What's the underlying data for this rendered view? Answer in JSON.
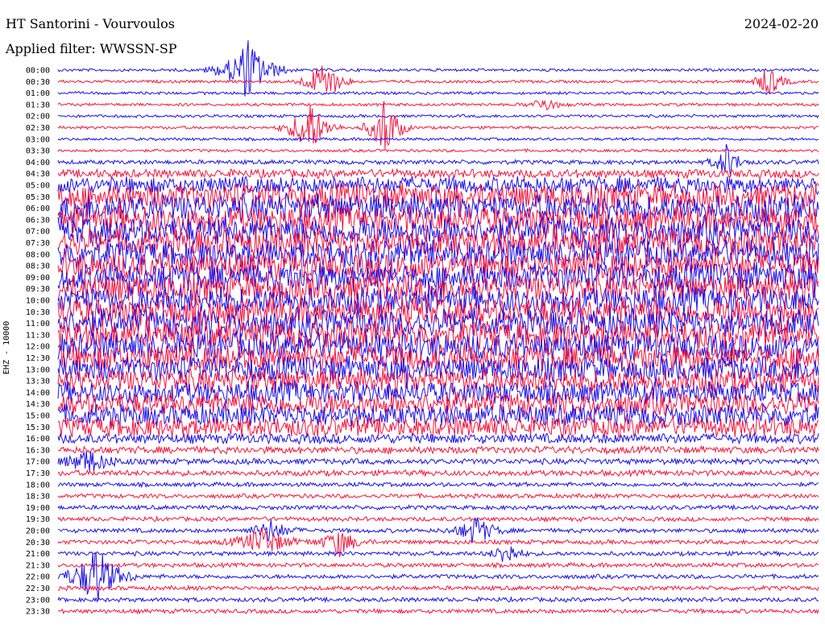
{
  "header": {
    "title": "HT Santorini - Vourvoulos",
    "filter": "Applied filter: WWSSN-SP",
    "date": "2024-02-20"
  },
  "chart_data": {
    "type": "line",
    "title": "HT Santorini - Vourvoulos",
    "subtitle": "Applied filter: WWSSN-SP",
    "ylabel": "EHZ - 10000",
    "colors": [
      "#1a10e8",
      "#f5143c"
    ],
    "categories": [
      "00:00",
      "00:30",
      "01:00",
      "01:30",
      "02:00",
      "02:30",
      "03:00",
      "03:30",
      "04:00",
      "04:30",
      "05:00",
      "05:30",
      "06:00",
      "06:30",
      "07:00",
      "07:30",
      "08:00",
      "08:30",
      "09:00",
      "09:30",
      "10:00",
      "10:30",
      "11:00",
      "11:30",
      "12:00",
      "12:30",
      "13:00",
      "13:30",
      "14:00",
      "14:30",
      "15:00",
      "15:30",
      "16:00",
      "16:30",
      "17:00",
      "17:30",
      "18:00",
      "18:30",
      "19:00",
      "19:30",
      "20:00",
      "20:30",
      "21:00",
      "21:30",
      "22:00",
      "22:30",
      "23:00",
      "23:30"
    ],
    "noise_level": [
      2,
      2,
      2,
      2,
      2,
      2,
      2,
      2,
      3,
      6,
      12,
      18,
      20,
      20,
      20,
      20,
      20,
      20,
      20,
      20,
      20,
      20,
      20,
      20,
      20,
      20,
      18,
      17,
      16,
      16,
      15,
      14,
      7,
      5,
      4,
      4,
      3,
      3,
      3,
      3,
      3,
      3,
      3,
      3,
      3,
      3,
      3,
      3
    ],
    "events": [
      {
        "row": 0,
        "pos": 0.25,
        "amp": 40,
        "width": 0.02
      },
      {
        "row": 1,
        "pos": 0.35,
        "amp": 30,
        "width": 0.015
      },
      {
        "row": 1,
        "pos": 0.935,
        "amp": 20,
        "width": 0.012
      },
      {
        "row": 3,
        "pos": 0.64,
        "amp": 10,
        "width": 0.012
      },
      {
        "row": 5,
        "pos": 0.33,
        "amp": 40,
        "width": 0.015
      },
      {
        "row": 5,
        "pos": 0.43,
        "amp": 45,
        "width": 0.012
      },
      {
        "row": 8,
        "pos": 0.88,
        "amp": 25,
        "width": 0.01
      },
      {
        "row": 34,
        "pos": 0.04,
        "amp": 15,
        "width": 0.02
      },
      {
        "row": 40,
        "pos": 0.28,
        "amp": 15,
        "width": 0.015
      },
      {
        "row": 40,
        "pos": 0.55,
        "amp": 20,
        "width": 0.015
      },
      {
        "row": 41,
        "pos": 0.27,
        "amp": 20,
        "width": 0.02
      },
      {
        "row": 41,
        "pos": 0.37,
        "amp": 18,
        "width": 0.015
      },
      {
        "row": 42,
        "pos": 0.59,
        "amp": 18,
        "width": 0.01
      },
      {
        "row": 44,
        "pos": 0.05,
        "amp": 40,
        "width": 0.02
      }
    ]
  }
}
